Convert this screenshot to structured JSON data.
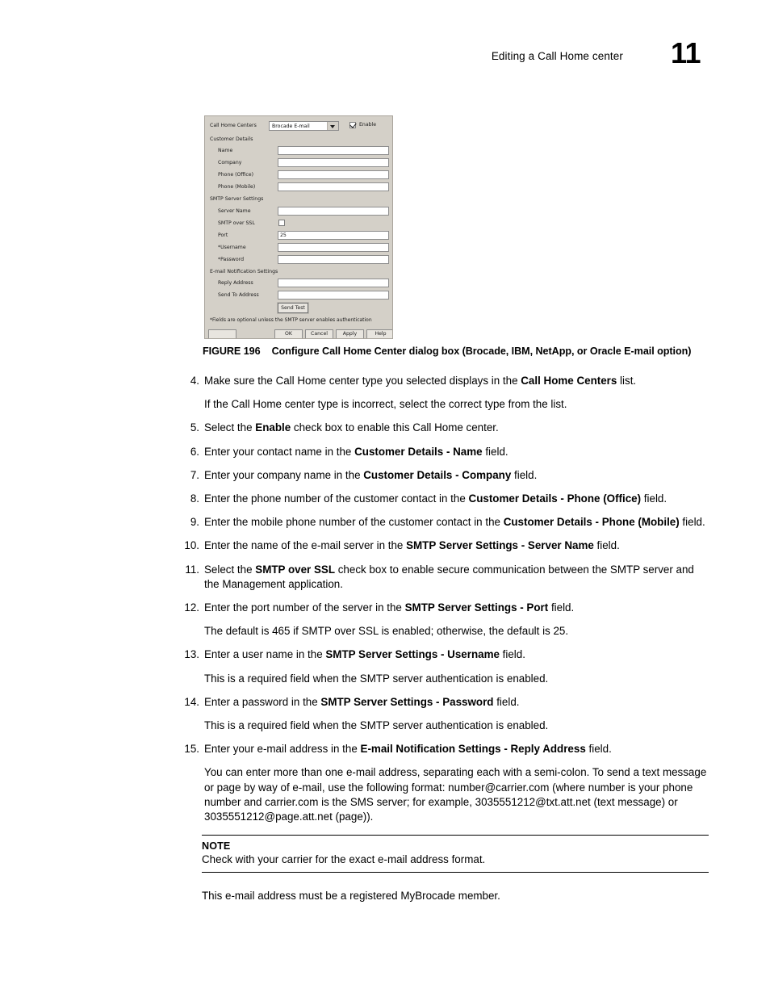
{
  "header": {
    "title": "Editing a Call Home center",
    "page_number": "11"
  },
  "figure": {
    "caption_number": "FIGURE 196",
    "caption_text": "Configure Call Home Center dialog box (Brocade, IBM, NetApp, or Oracle E-mail option)",
    "dialog": {
      "call_home_centers_label": "Call Home Centers",
      "call_home_centers_value": "Brocade E-mail",
      "enable_label": "Enable",
      "enable_checked": true,
      "customer_details_group": "Customer Details",
      "name_label": "Name",
      "name_value": "",
      "company_label": "Company",
      "company_value": "",
      "phone_office_label": "Phone (Office)",
      "phone_office_value": "",
      "phone_mobile_label": "Phone (Mobile)",
      "phone_mobile_value": "",
      "smtp_group": "SMTP Server Settings",
      "server_name_label": "Server Name",
      "server_name_value": "",
      "smtp_over_ssl_label": "SMTP over SSL",
      "smtp_over_ssl_checked": false,
      "port_label": "Port",
      "port_value": "25",
      "username_label": "*Username",
      "username_value": "",
      "password_label": "*Password",
      "password_value": "",
      "email_group": "E-mail Notification Settings",
      "reply_address_label": "Reply Address",
      "reply_address_value": "",
      "send_to_address_label": "Send To Address",
      "send_to_address_value": "",
      "send_test_button": "Send Test",
      "footnote": "*Fields are optional unless the SMTP server enables authentication",
      "ok_button": "OK",
      "cancel_button": "Cancel",
      "apply_button": "Apply",
      "help_button": "Help"
    }
  },
  "steps": {
    "s4_num": "4.",
    "s4_a": "Make sure the Call Home center type you selected displays in the ",
    "s4_b": "Call Home Centers",
    "s4_c": " list.",
    "s4_sub": "If the Call Home center type is incorrect, select the correct type from the list.",
    "s5_num": "5.",
    "s5_a": "Select the ",
    "s5_b": "Enable",
    "s5_c": " check box to enable this Call Home center.",
    "s6_num": "6.",
    "s6_a": "Enter your contact name in the ",
    "s6_b": "Customer Details - Name",
    "s6_c": " field.",
    "s7_num": "7.",
    "s7_a": "Enter your company name in the ",
    "s7_b": "Customer Details - Company",
    "s7_c": " field.",
    "s8_num": "8.",
    "s8_a": "Enter the phone number of the customer contact in the ",
    "s8_b": "Customer Details - Phone (Office)",
    "s8_c": " field.",
    "s9_num": "9.",
    "s9_a": "Enter the mobile phone number of the customer contact in the ",
    "s9_b": "Customer Details - Phone (Mobile)",
    "s9_c": " field.",
    "s10_num": "10.",
    "s10_a": "Enter the name of the e-mail server in the ",
    "s10_b": "SMTP Server Settings - Server Name",
    "s10_c": " field.",
    "s11_num": "11.",
    "s11_a": "Select the ",
    "s11_b": "SMTP over SSL",
    "s11_c": " check box to enable secure communication between the SMTP server and the Management application.",
    "s12_num": "12.",
    "s12_a": "Enter the port number of the server in the ",
    "s12_b": "SMTP Server Settings - Port",
    "s12_c": " field.",
    "s12_sub": "The default is 465 if SMTP over SSL is enabled; otherwise, the default is 25.",
    "s13_num": "13.",
    "s13_a": "Enter a user name in the ",
    "s13_b": "SMTP Server Settings - Username",
    "s13_c": " field.",
    "s13_sub": "This is a required field when the SMTP server authentication is enabled.",
    "s14_num": "14.",
    "s14_a": "Enter a password in the ",
    "s14_b": "SMTP Server Settings - Password",
    "s14_c": " field.",
    "s14_sub": "This is a required field when the SMTP server authentication is enabled.",
    "s15_num": "15.",
    "s15_a": "Enter your e-mail address in the ",
    "s15_b": "E-mail Notification Settings - Reply Address",
    "s15_c": " field.",
    "s15_sub": "You can enter more than one e-mail address, separating each with a semi-colon. To send a text message or page by way of e-mail, use the following format: number@carrier.com (where number is your phone number and carrier.com is the SMS server; for example, 3035551212@txt.att.net (text message) or 3035551212@page.att.net (page))."
  },
  "note": {
    "title": "NOTE",
    "text": "Check with your carrier for the exact e-mail address format."
  },
  "closing_text": "This e-mail address must be a registered MyBrocade member."
}
